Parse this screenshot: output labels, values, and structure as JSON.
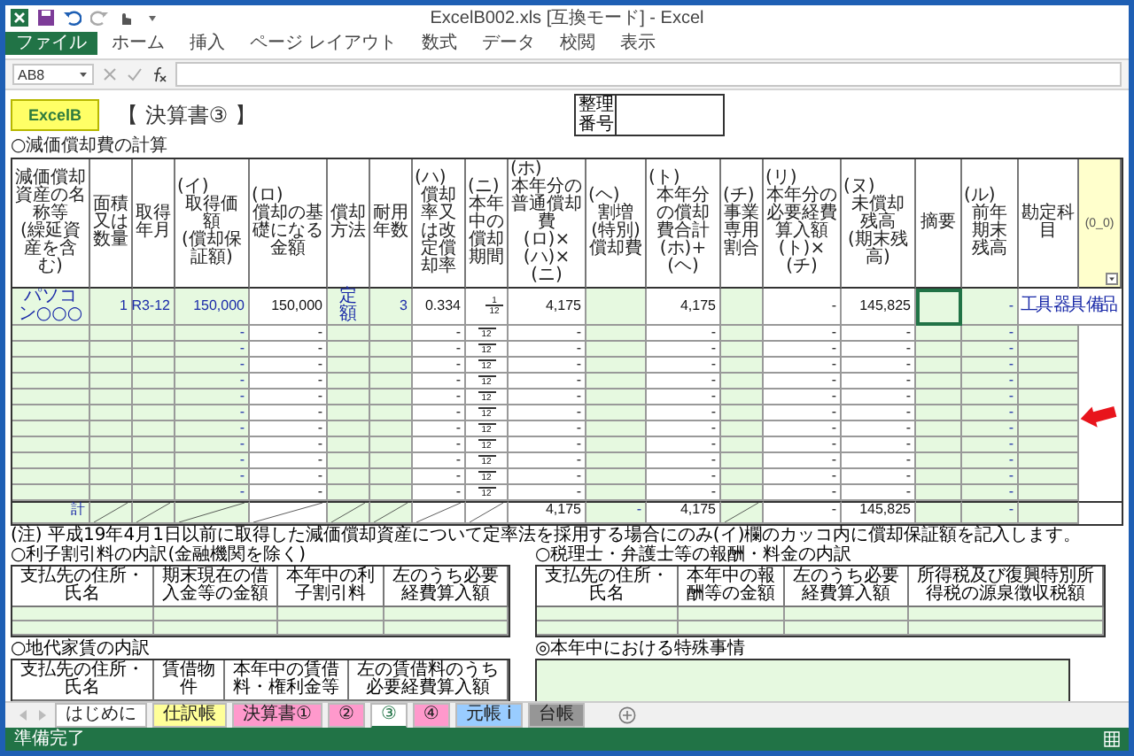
{
  "window": {
    "title": "ExcelB002.xls  [互換モード] - Excel"
  },
  "ribbon_tabs": [
    {
      "label": "ファイル",
      "kind": "file"
    },
    {
      "label": "ホーム",
      "kind": "tab"
    },
    {
      "label": "挿入",
      "kind": "tab"
    },
    {
      "label": "ページ レイアウト",
      "kind": "tab"
    },
    {
      "label": "数式",
      "kind": "tab"
    },
    {
      "label": "データ",
      "kind": "tab"
    },
    {
      "label": "校閲",
      "kind": "tab"
    },
    {
      "label": "表示",
      "kind": "tab"
    }
  ],
  "formula_bar": {
    "name_box": "AB8"
  },
  "sheet": {
    "logo": "ExcelB",
    "title": "【 決算書③ 】",
    "reference_label": "整理番号",
    "section_title": "○減価償却費の計算",
    "columns": [
      {
        "label": "減価償却資産の名称等",
        "sub": "(繰延資産を含む)",
        "kind": "input"
      },
      {
        "label": "面積又は数量",
        "kind": "input"
      },
      {
        "label": "取得年月",
        "kind": "input"
      },
      {
        "code": "(イ)",
        "label": "取得価額",
        "sub": "(償却保証額)",
        "kind": "input"
      },
      {
        "code": "(ロ)",
        "label": "償却の基礎になる金額",
        "kind": "calc"
      },
      {
        "label": "償却方法",
        "kind": "input"
      },
      {
        "label": "耐用年数",
        "kind": "input"
      },
      {
        "code": "(ハ)",
        "label": "償却率又は改定償却率",
        "kind": "calc"
      },
      {
        "code": "(ニ)",
        "label": "本年中の償却期間",
        "kind": "calc"
      },
      {
        "code": "(ホ)",
        "label": "本年分の普通償却費",
        "sub": "(ロ)×(ハ)×(ニ)",
        "kind": "calc"
      },
      {
        "code": "(ヘ)",
        "label": "割増(特別)償却費",
        "kind": "input"
      },
      {
        "code": "(ト)",
        "label": "本年分の償却費合計",
        "sub": "(ホ)+(ヘ)",
        "kind": "calc"
      },
      {
        "code": "(チ)",
        "label": "事業専用割合",
        "kind": "input"
      },
      {
        "code": "(リ)",
        "label": "本年分の必要経費算入額",
        "sub": "(ト)×(チ)",
        "kind": "calc"
      },
      {
        "code": "(ヌ)",
        "label": "未償却残高",
        "sub": "(期末残高)",
        "kind": "calc"
      },
      {
        "label": "摘要",
        "kind": "input"
      },
      {
        "code": "(ル)",
        "label": "前年期末残高",
        "kind": "input"
      },
      {
        "label": "勘定科目",
        "kind": "input"
      },
      {
        "label": "(0_0)",
        "kind": "flag"
      }
    ],
    "rows": [
      {
        "kind": "entry",
        "cells": [
          "パソコン○○○",
          "1",
          "R3-12",
          "150,000",
          "150,000",
          "定額",
          "3",
          "0.334",
          {
            "num": "1",
            "den": "12"
          },
          "4,175",
          null,
          "4,175",
          null,
          "-",
          "145,825",
          {
            "selected": true
          },
          "-",
          "工具 器具 備品"
        ]
      },
      {
        "kind": "entry",
        "cells": [
          null,
          null,
          null,
          "-",
          "-",
          null,
          null,
          "-",
          {
            "den": "12"
          },
          "-",
          null,
          "-",
          null,
          "-",
          "-",
          {
            "selected": false
          },
          "-",
          null
        ]
      },
      {
        "kind": "entry",
        "cells": [
          null,
          null,
          null,
          "-",
          "-",
          null,
          null,
          "-",
          {
            "den": "12"
          },
          "-",
          null,
          "-",
          null,
          "-",
          "-",
          {
            "selected": false
          },
          "-",
          null
        ]
      },
      {
        "kind": "entry",
        "cells": [
          null,
          null,
          null,
          "-",
          "-",
          null,
          null,
          "-",
          {
            "den": "12"
          },
          "-",
          null,
          "-",
          null,
          "-",
          "-",
          {
            "selected": false
          },
          "-",
          null
        ]
      },
      {
        "kind": "entry",
        "cells": [
          null,
          null,
          null,
          "-",
          "-",
          null,
          null,
          "-",
          {
            "den": "12"
          },
          "-",
          null,
          "-",
          null,
          "-",
          "-",
          {
            "selected": false
          },
          "-",
          null
        ]
      },
      {
        "kind": "entry",
        "cells": [
          null,
          null,
          null,
          "-",
          "-",
          null,
          null,
          "-",
          {
            "den": "12"
          },
          "-",
          null,
          "-",
          null,
          "-",
          "-",
          {
            "selected": false
          },
          "-",
          null
        ]
      },
      {
        "kind": "entry",
        "cells": [
          null,
          null,
          null,
          "-",
          "-",
          null,
          null,
          "-",
          {
            "den": "12"
          },
          "-",
          null,
          "-",
          null,
          "-",
          "-",
          {
            "selected": false
          },
          "-",
          null
        ]
      },
      {
        "kind": "entry",
        "cells": [
          null,
          null,
          null,
          "-",
          "-",
          null,
          null,
          "-",
          {
            "den": "12"
          },
          "-",
          null,
          "-",
          null,
          "-",
          "-",
          {
            "selected": false
          },
          "-",
          null
        ]
      },
      {
        "kind": "entry",
        "cells": [
          null,
          null,
          null,
          "-",
          "-",
          null,
          null,
          "-",
          {
            "den": "12"
          },
          "-",
          null,
          "-",
          null,
          "-",
          "-",
          {
            "selected": false
          },
          "-",
          null
        ]
      },
      {
        "kind": "entry",
        "cells": [
          null,
          null,
          null,
          "-",
          "-",
          null,
          null,
          "-",
          {
            "den": "12"
          },
          "-",
          null,
          "-",
          null,
          "-",
          "-",
          {
            "selected": false
          },
          "-",
          null
        ]
      },
      {
        "kind": "entry",
        "cells": [
          null,
          null,
          null,
          "-",
          "-",
          null,
          null,
          "-",
          {
            "den": "12"
          },
          "-",
          null,
          "-",
          null,
          "-",
          "-",
          {
            "selected": false
          },
          "-",
          null
        ]
      },
      {
        "kind": "entry",
        "cells": [
          null,
          null,
          null,
          "-",
          "-",
          null,
          null,
          "-",
          {
            "den": "12"
          },
          "-",
          null,
          "-",
          null,
          "-",
          "-",
          {
            "selected": false
          },
          "-",
          null
        ]
      },
      {
        "kind": "total",
        "cells": [
          "計",
          {
            "slashed": true
          },
          {
            "slashed": true
          },
          {
            "slashed": true
          },
          {
            "slashed": true
          },
          {
            "slashed": true
          },
          {
            "slashed": true
          },
          {
            "slashed": true
          },
          {
            "slashed": true
          },
          "4,175",
          "-",
          "4,175",
          {
            "slashed": true
          },
          "-",
          "145,825",
          {
            "selected": false
          },
          "-",
          null
        ]
      }
    ],
    "footnote": "(注) 平成19年4月1日以前に取得した減価償却資産について定率法を採用する場合にのみ(イ)欄のカッコ内に償却保証額を記入します。",
    "sections": [
      {
        "title": "○利子割引料の内訳(金融機関を除く)",
        "columns": [
          "支払先の住所・氏名",
          "期末現在の借入金等の金額",
          "本年中の利子割引料",
          "左のうち必要経費算入額"
        ]
      },
      {
        "title": "○税理士・弁護士等の報酬・料金の内訳",
        "columns": [
          "支払先の住所・氏名",
          "本年中の報酬等の金額",
          "左のうち必要経費算入額",
          "所得税及び復興特別所得税の源泉徴収税額"
        ]
      },
      {
        "title": "○地代家賃の内訳",
        "columns": [
          "支払先の住所・氏名",
          "賃借物件",
          "本年中の賃借料・権利金等",
          "左の賃借料のうち必要経費算入額"
        ]
      },
      {
        "title": "◎本年中における特殊事情",
        "kind": "notes"
      }
    ]
  },
  "sheet_tabs": [
    {
      "label": "はじめに",
      "color": "#ffffff",
      "selected": false
    },
    {
      "label": "仕訳帳",
      "color": "#ffff99",
      "selected": false
    },
    {
      "label": "決算書①",
      "color": "#ff99cc",
      "selected": false
    },
    {
      "label": "②",
      "color": "#ff99cc",
      "selected": false
    },
    {
      "label": "③",
      "color": "#ffffff",
      "selected": true
    },
    {
      "label": "④",
      "color": "#ff99cc",
      "selected": false
    },
    {
      "label": "元帳 i",
      "color": "#99ccff",
      "selected": false
    },
    {
      "label": "台帳",
      "color": "#969696",
      "selected": false
    }
  ],
  "status_bar": {
    "text": "準備完了"
  }
}
